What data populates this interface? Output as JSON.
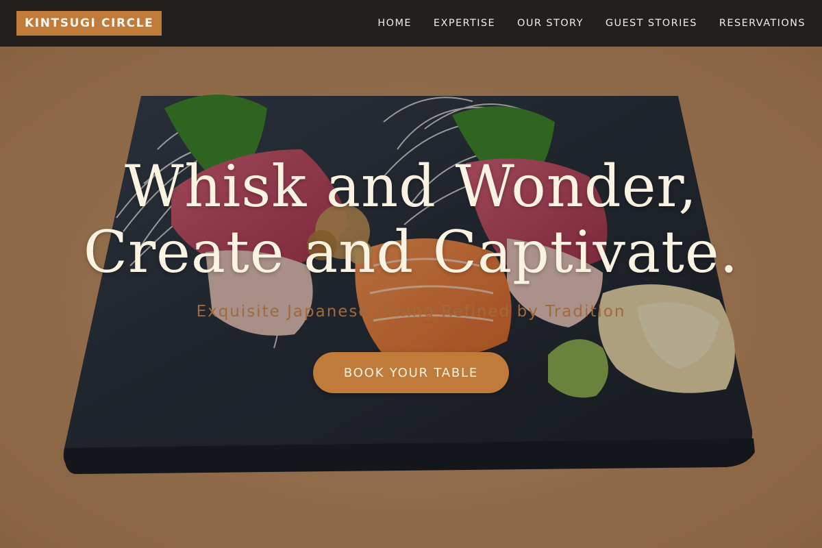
{
  "brand": {
    "name": "KINTSUGI CIRCLE"
  },
  "nav": {
    "items": [
      {
        "label": "HOME"
      },
      {
        "label": "EXPERTISE"
      },
      {
        "label": "OUR STORY"
      },
      {
        "label": "GUEST STORIES"
      },
      {
        "label": "RESERVATIONS"
      }
    ]
  },
  "hero": {
    "title_line1": "Whisk and Wonder,",
    "title_line2": "Create and Captivate.",
    "subtitle": "Exquisite Japanese Dining Refined by Tradition",
    "cta_label": "BOOK YOUR TABLE"
  },
  "colors": {
    "accent": "#c07a3a",
    "nav_background": "#221f1d",
    "hero_text": "#fbf3e2",
    "subtitle_text": "#a06a3b"
  }
}
